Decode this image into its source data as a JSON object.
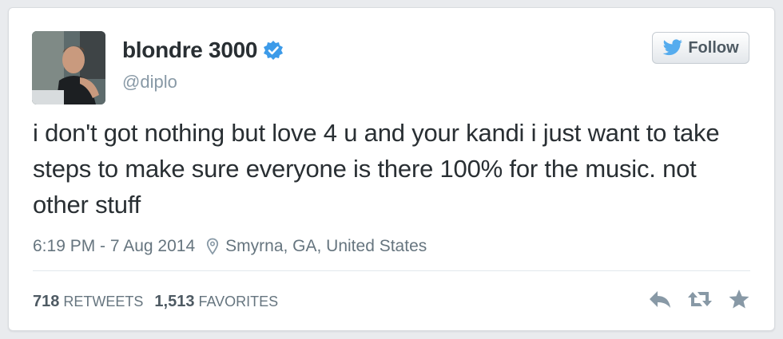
{
  "tweet": {
    "display_name": "blondre 3000",
    "handle": "@diplo",
    "follow_label": "Follow",
    "text": "i don't got nothing but love 4 u and your kandi i just want to take steps to make sure everyone is there 100% for the music. not other stuff",
    "time": "6:19 PM - 7 Aug 2014",
    "location": "Smyrna, GA, United States",
    "retweets_count": "718",
    "retweets_label": "RETWEETS",
    "favorites_count": "1,513",
    "favorites_label": "FAVORITES"
  },
  "icons": [
    "verified-badge-icon",
    "twitter-bird-icon",
    "location-pin-icon",
    "reply-icon",
    "retweet-icon",
    "favorite-star-icon"
  ],
  "colors": {
    "verified": "#3d9be9",
    "twitter_blue": "#55acee",
    "text": "#292f33",
    "muted": "#8899a6",
    "action_icon": "#8899a6"
  }
}
